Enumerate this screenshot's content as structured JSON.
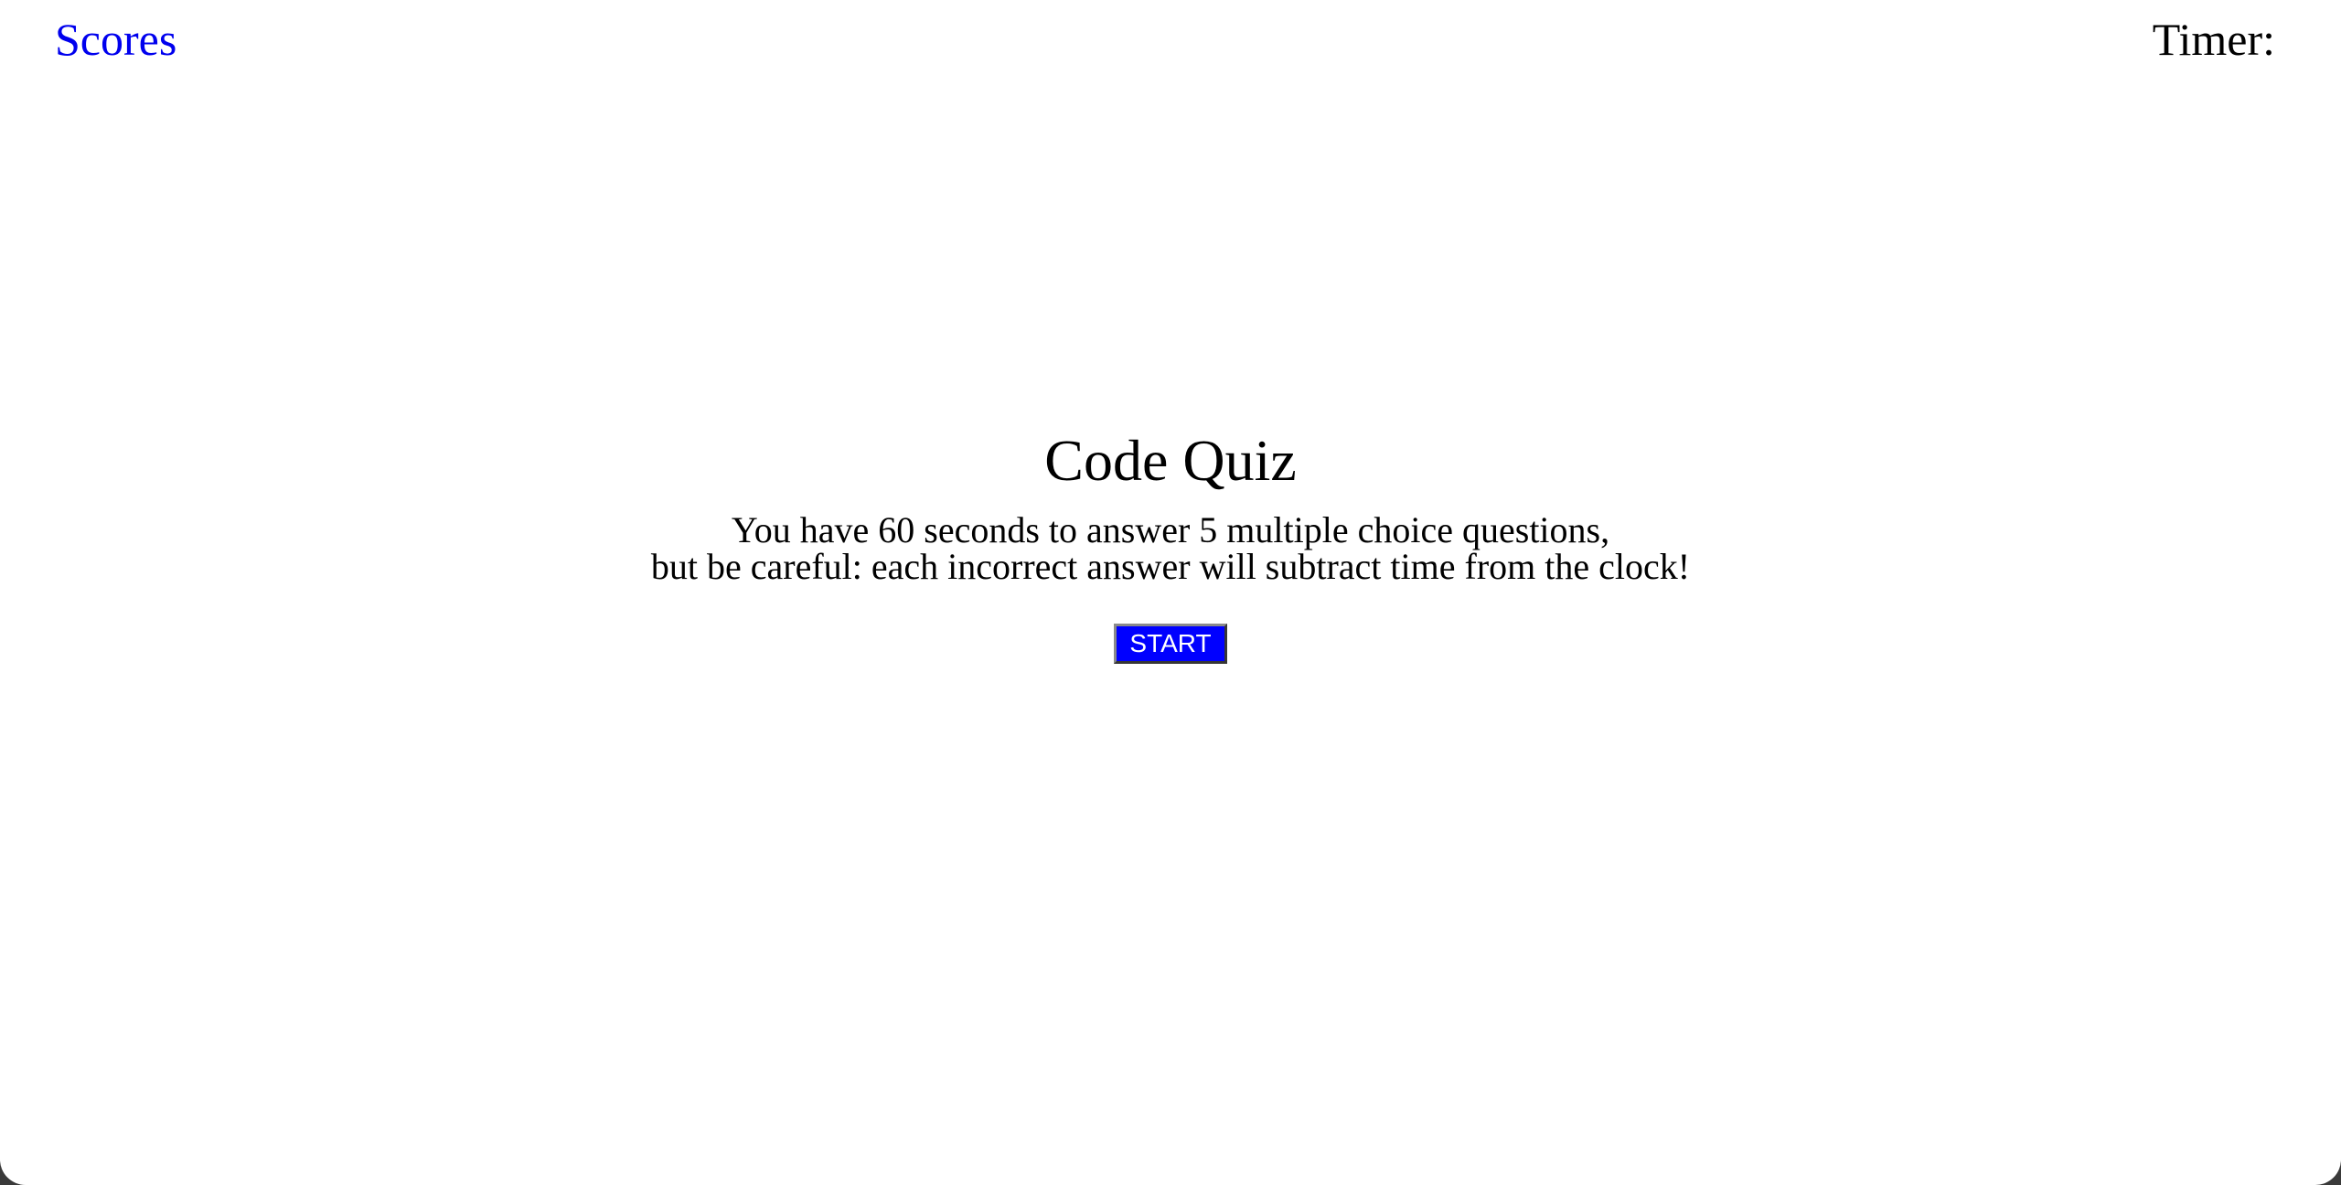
{
  "header": {
    "scores_link": "Scores",
    "timer_label": "Timer:",
    "timer_value": ""
  },
  "intro": {
    "title": "Code Quiz",
    "instructions_line1": "You have 60 seconds to answer 5 multiple choice questions,",
    "instructions_line2": "but be careful: each incorrect answer will subtract time from the clock!",
    "start_button": "START"
  },
  "colors": {
    "link": "#0000ee",
    "start_button_bg": "#0000ff",
    "start_button_text": "#ffffff",
    "page_bg": "#ffffff"
  }
}
